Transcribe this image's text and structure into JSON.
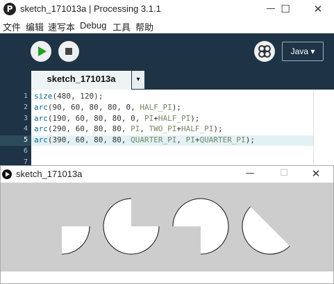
{
  "window": {
    "title": "sketch_171013a | Processing 3.1.1",
    "app_icon_glyph": "P"
  },
  "window_buttons": {
    "minimize": "—",
    "maximize": "☐",
    "close": "✕"
  },
  "menu": [
    "文件",
    "编辑",
    "速写本",
    "Debug",
    "工具",
    "帮助"
  ],
  "toolbar": {
    "mode_label": "Java ▾",
    "debug_icon": "butterfly-icon"
  },
  "tab": {
    "label": "sketch_171013a",
    "menu_arrow": "▾"
  },
  "editor": {
    "line_numbers": [
      "1",
      "2",
      "3",
      "4",
      "5",
      "6",
      "7"
    ],
    "highlighted_line": 5,
    "lines": [
      [
        {
          "t": "size",
          "c": "kw"
        },
        {
          "t": "(480, 120);",
          "c": ""
        }
      ],
      [
        {
          "t": "arc",
          "c": "kw"
        },
        {
          "t": "(90, 60, 80, 80, 0, ",
          "c": ""
        },
        {
          "t": "HALF_PI",
          "c": "cst"
        },
        {
          "t": ");",
          "c": ""
        }
      ],
      [
        {
          "t": "arc",
          "c": "kw"
        },
        {
          "t": "(190, 60, 80, 80, 0, ",
          "c": ""
        },
        {
          "t": "PI",
          "c": "cst"
        },
        {
          "t": "+",
          "c": ""
        },
        {
          "t": "HALF_PI",
          "c": "cst"
        },
        {
          "t": ");",
          "c": ""
        }
      ],
      [
        {
          "t": "arc",
          "c": "kw"
        },
        {
          "t": "(290, 60, 80, 80, ",
          "c": ""
        },
        {
          "t": "PI",
          "c": "cst"
        },
        {
          "t": ", ",
          "c": ""
        },
        {
          "t": "TWO_PI",
          "c": "cst"
        },
        {
          "t": "+",
          "c": ""
        },
        {
          "t": "HALF_PI",
          "c": "cst"
        },
        {
          "t": ");",
          "c": ""
        }
      ],
      [
        {
          "t": "arc",
          "c": "kw"
        },
        {
          "t": "(390, 60, 80, 80, ",
          "c": ""
        },
        {
          "t": "QUARTER_PI",
          "c": "cst"
        },
        {
          "t": ", ",
          "c": ""
        },
        {
          "t": "PI",
          "c": "cst"
        },
        {
          "t": "+",
          "c": ""
        },
        {
          "t": "QUARTER_PI",
          "c": "cst"
        },
        {
          "t": ");",
          "c": ""
        }
      ],
      [],
      []
    ]
  },
  "sketch_window": {
    "title": "sketch_171013a"
  },
  "colors": {
    "toolbar_bg": "#1e3446",
    "keyword": "#006699",
    "constant": "#718a62",
    "canvas_bg": "#cdcdcd",
    "run_icon": "#20a020"
  }
}
